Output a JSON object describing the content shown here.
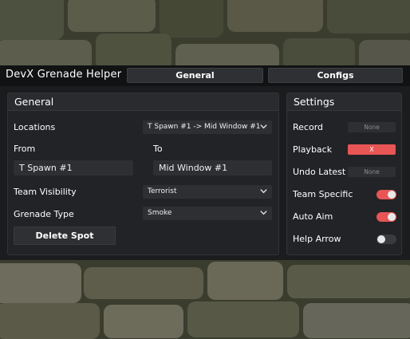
{
  "app": {
    "title": "DevX Grenade Helper"
  },
  "tabs": [
    {
      "label": "General",
      "active": true
    },
    {
      "label": "Configs",
      "active": false
    }
  ],
  "general": {
    "heading": "General",
    "locations_label": "Locations",
    "locations_value": "T Spawn #1 -> Mid Window #1",
    "from_label": "From",
    "from_value": "T Spawn #1",
    "to_label": "To",
    "to_value": "Mid Window #1",
    "team_visibility_label": "Team Visibility",
    "team_visibility_value": "Terrorist",
    "grenade_type_label": "Grenade Type",
    "grenade_type_value": "Smoke",
    "delete_button": "Delete Spot"
  },
  "settings": {
    "heading": "Settings",
    "record_label": "Record",
    "record_key": "None",
    "playback_label": "Playback",
    "playback_key": "X",
    "undo_label": "Undo Latest",
    "undo_key": "None",
    "team_specific_label": "Team Specific",
    "team_specific_on": true,
    "auto_aim_label": "Auto Aim",
    "auto_aim_on": true,
    "help_arrow_label": "Help Arrow",
    "help_arrow_on": false
  },
  "colors": {
    "accent": "#e85555",
    "panel": "#222326",
    "background": "#1b1c1e"
  }
}
